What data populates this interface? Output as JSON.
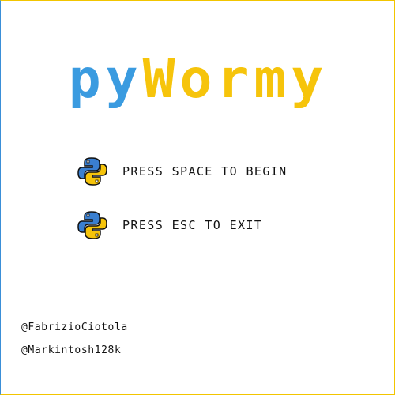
{
  "title": {
    "part1": "py",
    "part2": "Wormy",
    "colors": {
      "part1": "#3a9be0",
      "part2": "#f6c40b"
    }
  },
  "menu": [
    {
      "icon": "python-logo-icon",
      "label": "PRESS SPACE TO BEGIN"
    },
    {
      "icon": "python-logo-icon",
      "label": "PRESS ESC TO EXIT"
    }
  ],
  "credits": [
    "@FabrizioCiotola",
    "@Markintosh128k"
  ]
}
